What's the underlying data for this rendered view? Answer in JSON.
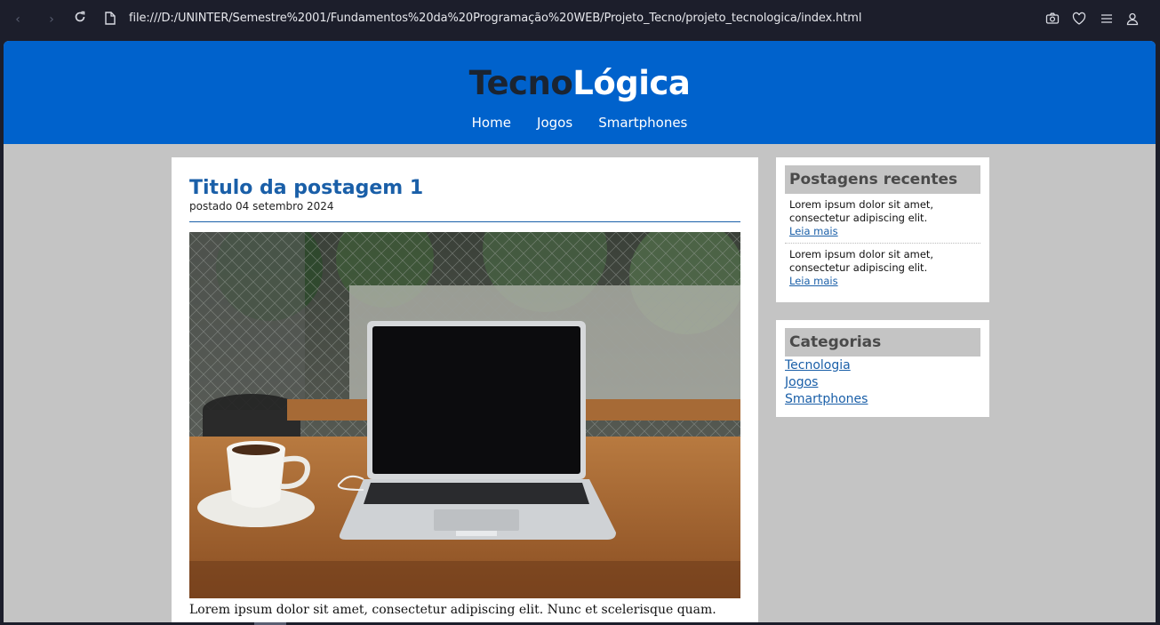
{
  "browser": {
    "url": "file:///D:/UNINTER/Semestre%2001/Fundamentos%20da%20Programação%20WEB/Projeto_Tecno/projeto_tecnologica/index.html",
    "icons": [
      "back-icon",
      "forward-icon",
      "reload-icon",
      "file-icon",
      "camera-icon",
      "heart-icon",
      "menu-icon",
      "profile-icon"
    ]
  },
  "site": {
    "logo_part1": "Tecno",
    "logo_part2": "Lógica",
    "nav": [
      "Home",
      "Jogos",
      "Smartphones"
    ]
  },
  "post": {
    "title": "Titulo da postagem 1",
    "date": "postado 04 setembro 2024",
    "text": "Lorem ipsum dolor sit amet, consectetur adipiscing elit. Nunc et scelerisque quam."
  },
  "sidebar": {
    "recent_title": "Postagens recentes",
    "recent": [
      {
        "text": "Lorem ipsum dolor sit amet, consectetur adipiscing elit.",
        "link": "Leia mais"
      },
      {
        "text": "Lorem ipsum dolor sit amet, consectetur adipiscing elit.",
        "link": "Leia mais"
      }
    ],
    "categories_title": "Categorias",
    "categories": [
      "Tecnologia",
      "Jogos",
      "Smartphones"
    ]
  },
  "colors": {
    "header": "#0062cc",
    "link": "#1a5fa8",
    "background": "#c4c4c4"
  }
}
